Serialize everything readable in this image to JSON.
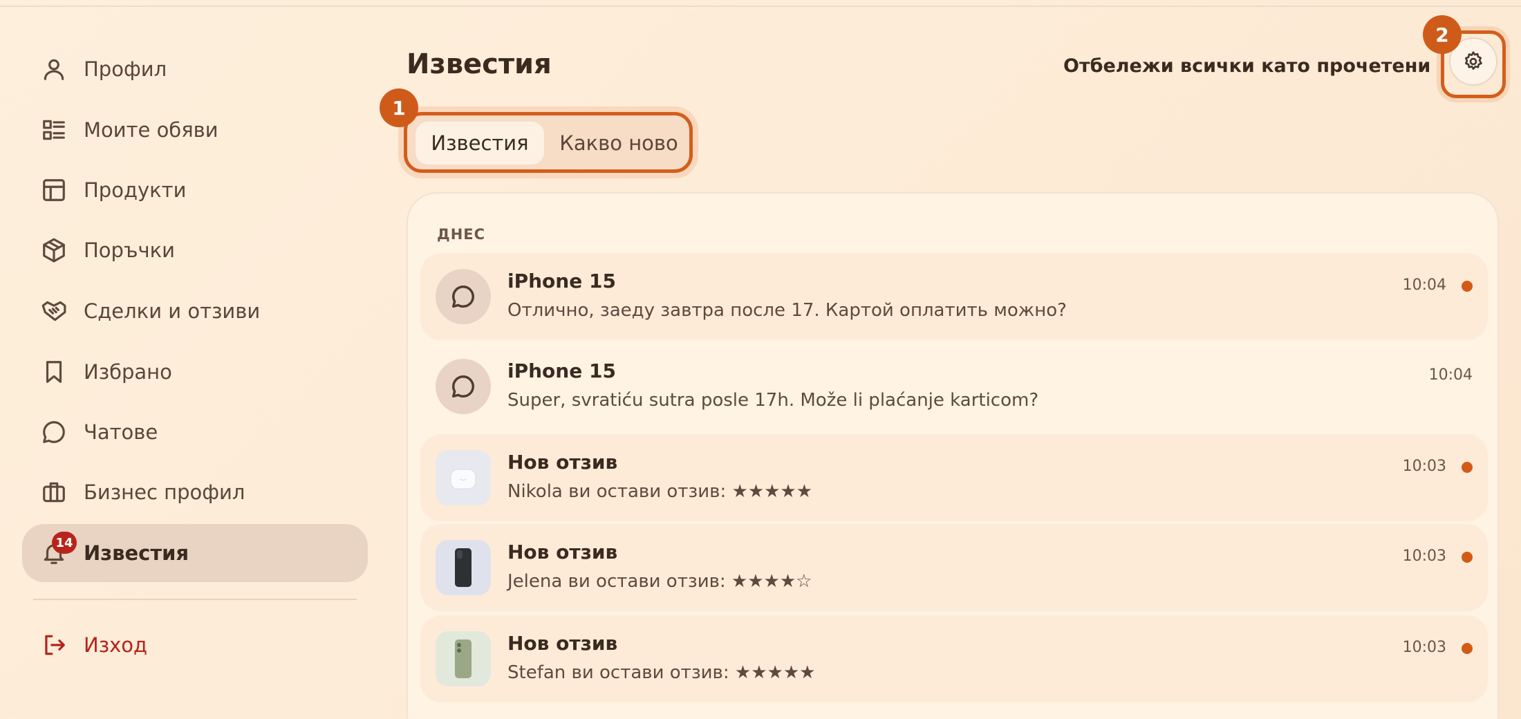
{
  "sidebar": {
    "items": [
      {
        "label": "Профил",
        "icon": "user-icon"
      },
      {
        "label": "Моите обяви",
        "icon": "list-icon"
      },
      {
        "label": "Продукти",
        "icon": "table-icon"
      },
      {
        "label": "Поръчки",
        "icon": "package-icon"
      },
      {
        "label": "Сделки и отзиви",
        "icon": "handshake-icon"
      },
      {
        "label": "Избрано",
        "icon": "bookmark-icon"
      },
      {
        "label": "Чатове",
        "icon": "chat-icon"
      },
      {
        "label": "Бизнес профил",
        "icon": "briefcase-icon"
      },
      {
        "label": "Известия",
        "icon": "bell-icon",
        "badge": "14",
        "active": true
      }
    ],
    "logout": {
      "label": "Изход",
      "icon": "logout-icon"
    }
  },
  "header": {
    "title": "Известия",
    "mark_all_label": "Отбележи всички като прочетени",
    "settings_icon": "gear-icon"
  },
  "tabs": [
    {
      "label": "Известия",
      "selected": true
    },
    {
      "label": "Какво ново",
      "selected": false
    }
  ],
  "annotations": {
    "step1": "1",
    "step2": "2"
  },
  "notifications": {
    "section_label": "ДНЕС",
    "items": [
      {
        "title": "iPhone 15",
        "text": "Отлично, заеду завтра после 17. Картой оплатить можно?",
        "time": "10:04",
        "unread": true,
        "avatar": "chat-icon"
      },
      {
        "title": "iPhone 15",
        "text": "Super, svratiću sutra posle 17h. Može li plaćanje karticom?",
        "time": "10:04",
        "unread": false,
        "avatar": "chat-icon"
      },
      {
        "title": "Нов отзив",
        "text": "Nikola ви остави отзив: ★★★★★",
        "time": "10:03",
        "unread": true,
        "avatar": "product-photo-earbuds"
      },
      {
        "title": "Нов отзив",
        "text": "Jelena ви остави отзив: ★★★★☆",
        "time": "10:03",
        "unread": true,
        "avatar": "product-photo-phone-black"
      },
      {
        "title": "Нов отзив",
        "text": "Stefan ви остави отзив: ★★★★★",
        "time": "10:03",
        "unread": true,
        "avatar": "product-photo-phone-green"
      }
    ]
  },
  "colors": {
    "accent": "#d35e1c",
    "badge": "#b8241b",
    "active_nav": "#e9d4c3",
    "logout": "#b3231c"
  }
}
